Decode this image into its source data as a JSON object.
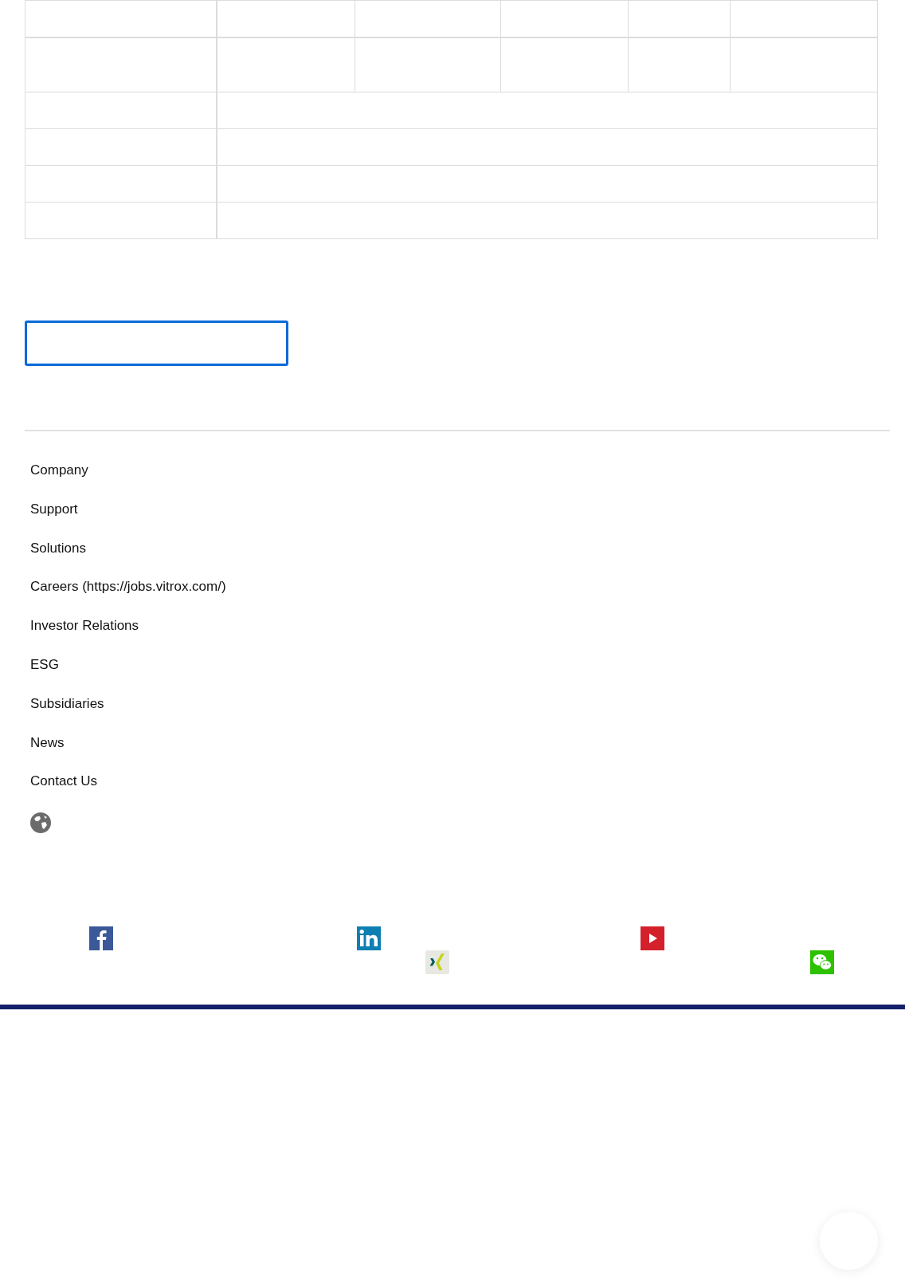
{
  "table": {
    "rows": [
      {
        "kind": "six-cell"
      },
      {
        "kind": "six-cell-tall"
      },
      {
        "kind": "two-cell"
      },
      {
        "kind": "two-cell"
      },
      {
        "kind": "two-cell"
      },
      {
        "kind": "two-cell"
      }
    ]
  },
  "footer_links": [
    "Company",
    "Support",
    "Solutions",
    "Careers (https://jobs.vitrox.com/)",
    "Investor Relations",
    "ESG",
    "Subsidiaries",
    "News",
    "Contact Us"
  ],
  "social_links": [
    {
      "kind": "facebook"
    },
    {
      "kind": "linkedin"
    },
    {
      "kind": "xing"
    },
    {
      "kind": "youtube"
    },
    {
      "kind": "wechat"
    }
  ]
}
